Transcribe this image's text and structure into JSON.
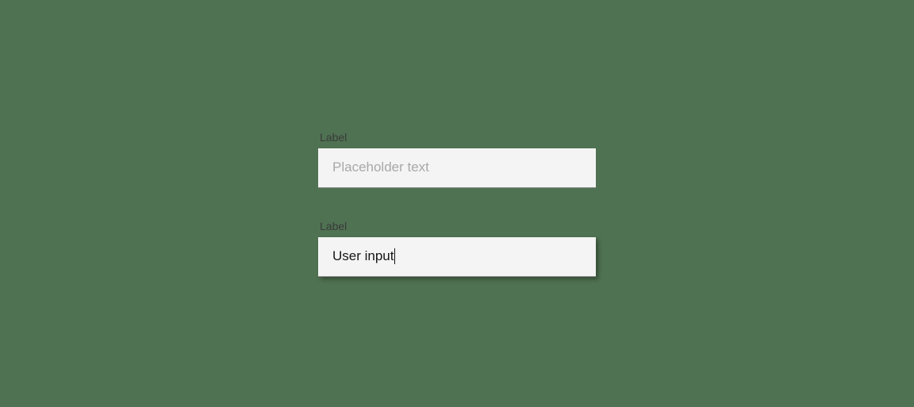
{
  "form": {
    "field1": {
      "label": "Label",
      "placeholder": "Placeholder text",
      "value": ""
    },
    "field2": {
      "label": "Label",
      "value": "User input"
    }
  }
}
